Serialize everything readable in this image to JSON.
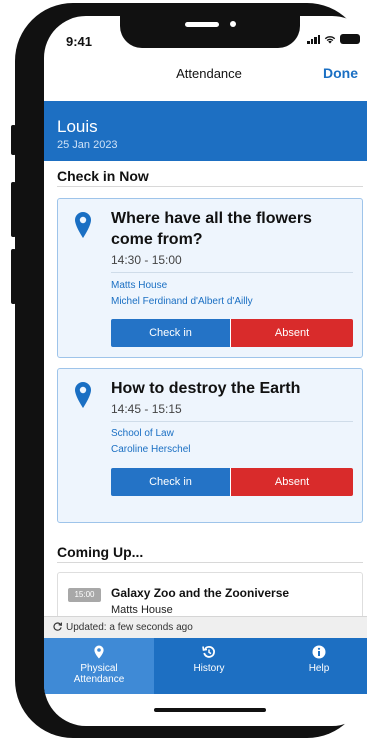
{
  "status_bar": {
    "time": "9:41"
  },
  "nav": {
    "title": "Attendance",
    "done_label": "Done"
  },
  "profile": {
    "name": "Louis",
    "date": "25 Jan 2023"
  },
  "check_in_now": {
    "heading": "Check in Now",
    "sessions": [
      {
        "title": "Where have all the flowers come from?",
        "time": "14:30 - 15:00",
        "location": "Matts House",
        "staff": "Michel Ferdinand d'Albert d'Ailly",
        "check_in_label": "Check in",
        "absent_label": "Absent"
      },
      {
        "title": "How to destroy the Earth",
        "time": "14:45 - 15:15",
        "location": "School of Law",
        "staff": "Caroline Herschel",
        "check_in_label": "Check in",
        "absent_label": "Absent"
      }
    ]
  },
  "coming_up": {
    "heading": "Coming Up...",
    "items": [
      {
        "time": "15:00",
        "title": "Galaxy Zoo and the Zooniverse",
        "location": "Matts House"
      }
    ]
  },
  "refresh": {
    "text": "Updated: a few seconds ago"
  },
  "tabbar": {
    "tabs": [
      {
        "label": "Physical Attendance",
        "icon": "map-pin-icon",
        "active": true
      },
      {
        "label": "History",
        "icon": "history-icon",
        "active": false
      },
      {
        "label": "Help",
        "icon": "info-icon",
        "active": false
      }
    ]
  },
  "colors": {
    "primary": "#1d6fc2",
    "absent": "#d92b2b",
    "card_bg": "#eef5fd"
  }
}
